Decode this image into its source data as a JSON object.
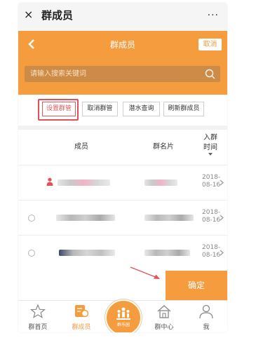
{
  "window": {
    "title": "群成员",
    "more": "···",
    "close": "×"
  },
  "header": {
    "title": "群成员",
    "cancel_label": "取消"
  },
  "search": {
    "placeholder": "请输入搜索关键词"
  },
  "actions": [
    {
      "label": "设置群管",
      "selected": true
    },
    {
      "label": "取消群管",
      "selected": false
    },
    {
      "label": "潜水查询",
      "selected": false
    },
    {
      "label": "刷新群成员",
      "selected": false
    }
  ],
  "table": {
    "columns": {
      "member": "成员",
      "card": "群名片",
      "join_time_1": "入群",
      "join_time_2": "时间"
    },
    "rows": [
      {
        "date_1": "2018-",
        "date_2": "08-16",
        "admin": true
      },
      {
        "date_1": "2018-",
        "date_2": "08-16",
        "admin": false
      },
      {
        "date_1": "2018-",
        "date_2": "08-16",
        "admin": false
      }
    ]
  },
  "confirm_label": "确定",
  "tabbar": {
    "items": [
      {
        "label": "群首页"
      },
      {
        "label": "群成员"
      },
      {
        "label": "群乐园"
      },
      {
        "label": "群中心"
      },
      {
        "label": "我"
      }
    ]
  },
  "colors": {
    "accent": "#f49c3e",
    "highlight": "#e2505a"
  }
}
